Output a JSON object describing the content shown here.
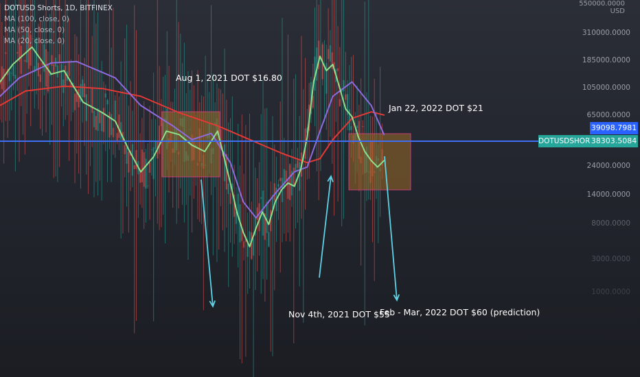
{
  "legend": {
    "symbol_line": "DOTUSD Shorts, 1D, BITFINEX",
    "ma_lines": [
      "MA (100, close, 0)",
      "MA (50, close, 0)",
      "MA (20, close, 0)"
    ]
  },
  "axis": {
    "unit_top": "550000.0000",
    "unit": "USD",
    "tick_labels": [
      "310000.0000",
      "185000.0000",
      "105000.0000",
      "65000.0000",
      "24000.0000",
      "14000.0000",
      "8000.0000",
      "3000.0000",
      "1000.0000"
    ]
  },
  "price_tags": {
    "last_value": "39098.7981",
    "symbol_label": "DOTUSDSHORTS",
    "symbol_value": "38303.5084"
  },
  "annotations": {
    "aug": "Aug 1, 2021 DOT $16.80",
    "jan": "Jan 22, 2022 DOT $21",
    "nov": "Nov 4th, 2021 DOT $55",
    "feb": "Feb - Mar,  2022 DOT $60 (prediction)"
  },
  "colors": {
    "ma100": "#e53935",
    "ma50": "#8e6be0",
    "ma20": "#8fe08a",
    "hline": "#3d6ef5",
    "arrow": "#5ed2e6",
    "box_fill": "#9a6a26",
    "box_stroke": "#c2407a",
    "up_candle": "#26a69a",
    "down_candle": "#ef5350",
    "last_tag": "#2962ff",
    "symbol_tag": "#26a69a"
  },
  "chart_data": {
    "type": "line",
    "title": "DOTUSD Shorts, 1D, BITFINEX",
    "y_scale": "log",
    "y_unit": "USD",
    "ylim": [
      1000,
      550000
    ],
    "price_lines": [
      39098.7981,
      38303.5084
    ],
    "series": [
      {
        "name": "MA (100, close, 0)",
        "x": [
          0,
          0.04,
          0.1,
          0.16,
          0.22,
          0.28,
          0.34,
          0.4,
          0.44,
          0.48,
          0.5,
          0.52,
          0.55,
          0.58,
          0.6
        ],
        "values": [
          75000,
          100000,
          110000,
          105000,
          90000,
          65000,
          50000,
          36000,
          29000,
          24000,
          26000,
          38000,
          58000,
          66000,
          62000
        ]
      },
      {
        "name": "MA (50, close, 0)",
        "x": [
          0,
          0.03,
          0.08,
          0.12,
          0.18,
          0.22,
          0.27,
          0.3,
          0.33,
          0.36,
          0.38,
          0.4,
          0.43,
          0.46,
          0.48,
          0.5,
          0.52,
          0.55,
          0.58,
          0.6
        ],
        "values": [
          90000,
          130000,
          175000,
          180000,
          130000,
          75000,
          50000,
          38000,
          43000,
          24000,
          11000,
          8000,
          13000,
          20000,
          22000,
          45000,
          90000,
          120000,
          75000,
          42000
        ]
      },
      {
        "name": "MA (20, close, 0)",
        "x": [
          0,
          0.02,
          0.05,
          0.08,
          0.1,
          0.13,
          0.16,
          0.18,
          0.2,
          0.22,
          0.24,
          0.26,
          0.28,
          0.3,
          0.32,
          0.34,
          0.36,
          0.37,
          0.38,
          0.39,
          0.4,
          0.41,
          0.42,
          0.43,
          0.44,
          0.45,
          0.46,
          0.47,
          0.48,
          0.49,
          0.5,
          0.51,
          0.52,
          0.53,
          0.54,
          0.55,
          0.56,
          0.57,
          0.58,
          0.59,
          0.6
        ],
        "values": [
          120000,
          170000,
          240000,
          140000,
          150000,
          80000,
          65000,
          55000,
          32000,
          20000,
          27000,
          45000,
          42000,
          34000,
          30000,
          45000,
          16000,
          9000,
          6000,
          4500,
          6500,
          9000,
          7000,
          11000,
          14000,
          16000,
          15000,
          21000,
          40000,
          120000,
          200000,
          150000,
          170000,
          110000,
          70000,
          60000,
          40000,
          30000,
          25000,
          22000,
          25000
        ]
      }
    ]
  }
}
